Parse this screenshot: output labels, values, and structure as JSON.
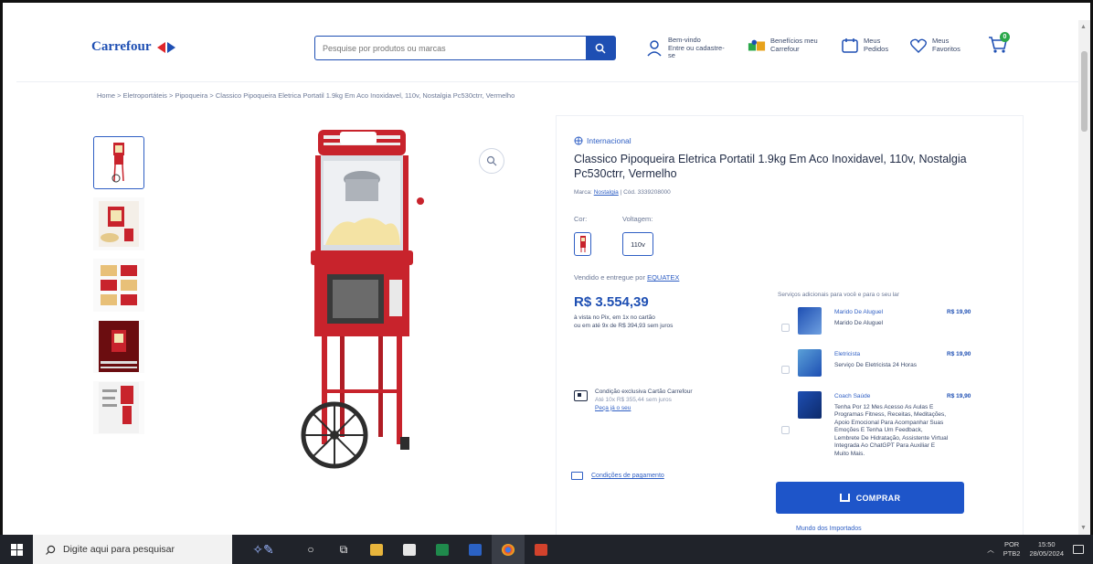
{
  "header": {
    "logo_text": "Carrefour",
    "search_placeholder": "Pesquise por produtos ou marcas",
    "account_line1": "Bem-vindo",
    "account_line2": "Entre ou cadastre-se",
    "benefits_line1": "Benefícios meu",
    "benefits_line2": "Carrefour",
    "orders_line1": "Meus",
    "orders_line2": "Pedidos",
    "favorites_line1": "Meus",
    "favorites_line2": "Favoritos",
    "cart_count": "0"
  },
  "breadcrumb": "Home > Eletroportáteis > Pipoqueira > Classico Pipoqueira Eletrica Portatil 1.9kg Em Aco Inoxidavel, 110v, Nostalgia Pc530ctrr, Vermelho",
  "product": {
    "badge": "Internacional",
    "title": "Classico Pipoqueira Eletrica Portatil 1.9kg Em Aco Inoxidavel, 110v, Nostalgia Pc530ctrr, Vermelho",
    "brand_prefix": "Marca:",
    "brand": "Nostalgia",
    "sku": "| Cód. 3339208000",
    "color_label": "Cor:",
    "voltage_label": "Voltagem:",
    "voltage_value": "110v",
    "sold_by_prefix": "Vendido e entregue por",
    "sold_by": "EQUATEX",
    "price": "R$ 3.554,39",
    "price_line1": "à vista no Pix, em 1x no cartão",
    "price_line2": "ou em até 9x de R$ 394,93 sem juros",
    "card_offer_line1": "Condição exclusiva Cartão Carrefour",
    "card_offer_line2": "Até 10x R$ 355,44 sem juros",
    "card_offer_link": "Peça já o seu",
    "shipping_link": "Condições de pagamento"
  },
  "services": {
    "title": "Serviços adicionais para você e para o seu lar",
    "items": [
      {
        "name": "Marido De Aluguel",
        "desc": "Marido De Aluguel",
        "price": "R$ 19,90"
      },
      {
        "name": "Eletricista",
        "desc": "Serviço De Eletricista 24 Horas",
        "price": "R$ 19,90"
      },
      {
        "name": "Coach Saúde",
        "desc": "Tenha Por 12 Mes Acesso As Aulas E Programas Fitness, Receitas, Meditações, Apoio Emocional Para Acompanhar Suas Emoções E Tenha Um Feedback, Lembrete De Hidratação, Assistente Virtual Integrada Ao ChatGPT Para Auxiliar E Muito Mais.",
        "price": "R$ 19,90"
      }
    ]
  },
  "buy_button": "COMPRAR",
  "extra_link": "Mundo dos Importados",
  "taskbar": {
    "search_placeholder": "Digite aqui para pesquisar",
    "lang_line1": "POR",
    "lang_line2": "PTB2",
    "time": "15:50",
    "date": "28/05/2024"
  },
  "colors": {
    "brand_blue": "#1e4fb3",
    "button_blue": "#1e55c9",
    "product_red": "#c8232c"
  }
}
